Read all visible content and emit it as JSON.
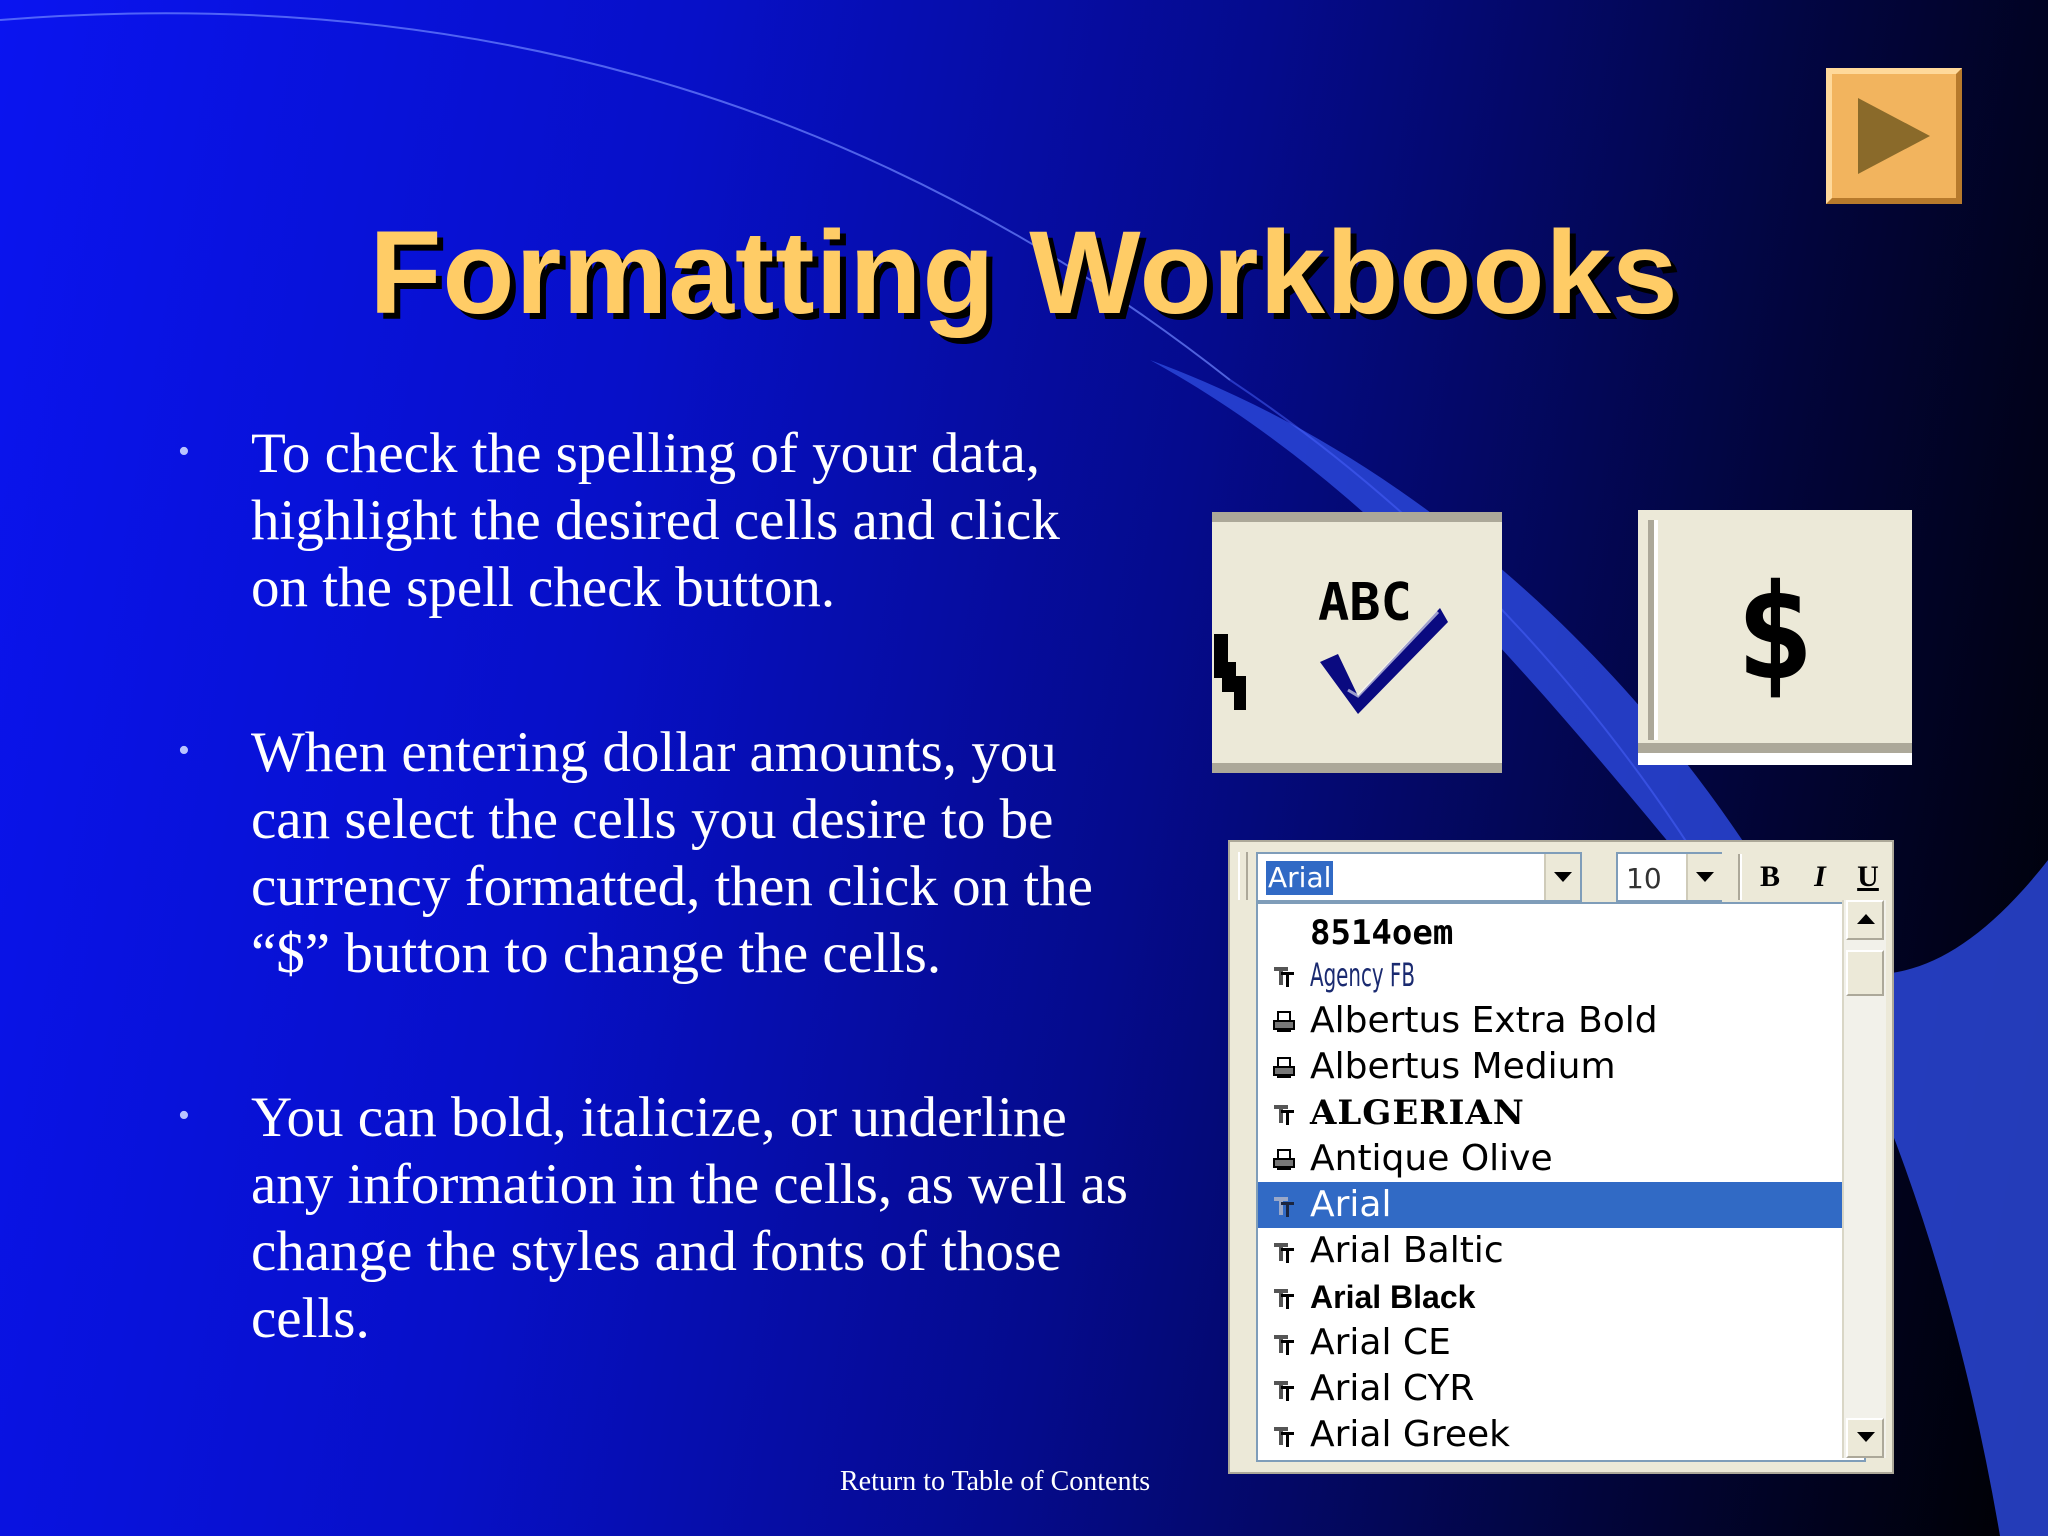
{
  "slide": {
    "title": "Formatting Workbooks",
    "bullets": [
      "To check the spelling of your data, highlight the desired cells and click on the spell check button.",
      "When entering dollar amounts, you can select the cells you desire to be currency formatted, then click on the “$” button to change the cells.",
      "You can bold, italicize, or underline any information in the cells, as well as change the styles and fonts of those cells."
    ],
    "bullet_symbol": "•",
    "toc_link": "Return to Table of Contents",
    "next_button_icon": "play-arrow-icon",
    "colors": {
      "title": "#ffcc66",
      "accent": "#f2b45e",
      "selection": "#316ac5"
    }
  },
  "spell_button": {
    "label": "ABC",
    "icon": "spell-check-icon"
  },
  "currency_button": {
    "label": "$"
  },
  "font_toolbar": {
    "font_name": "Arial",
    "font_size": "10",
    "bold_label": "B",
    "italic_label": "I",
    "underline_label": "U",
    "fonts": [
      {
        "name": "8514oem",
        "icon": "none"
      },
      {
        "name": "Agency FB",
        "icon": "truetype-icon"
      },
      {
        "name": "Albertus Extra Bold",
        "icon": "printer-font-icon"
      },
      {
        "name": "Albertus Medium",
        "icon": "printer-font-icon"
      },
      {
        "name": "ALGERIAN",
        "icon": "truetype-icon"
      },
      {
        "name": "Antique Olive",
        "icon": "printer-font-icon"
      },
      {
        "name": "Arial",
        "icon": "truetype-icon",
        "selected": true
      },
      {
        "name": "Arial Baltic",
        "icon": "truetype-icon"
      },
      {
        "name": "Arial Black",
        "icon": "truetype-icon"
      },
      {
        "name": "Arial CE",
        "icon": "truetype-icon"
      },
      {
        "name": "Arial CYR",
        "icon": "truetype-icon"
      },
      {
        "name": "Arial Greek",
        "icon": "truetype-icon"
      }
    ]
  }
}
